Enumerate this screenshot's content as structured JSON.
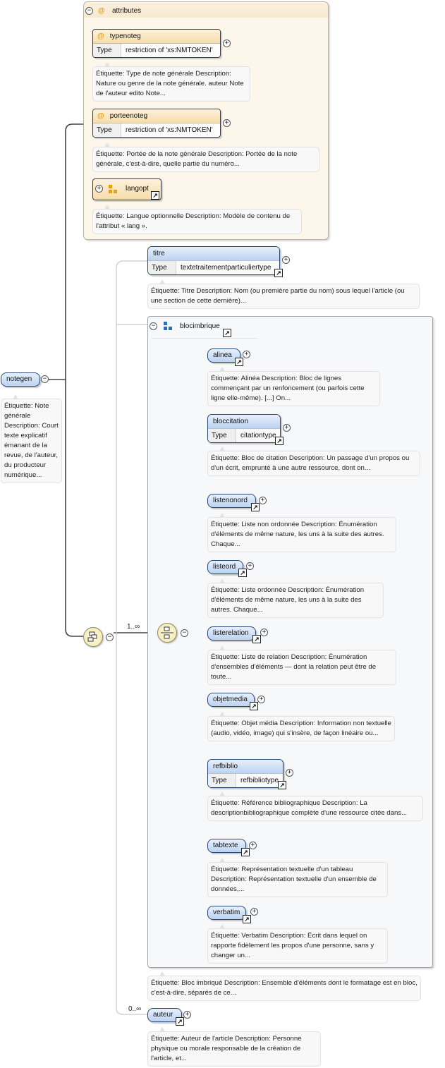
{
  "root": {
    "name": "notegen",
    "annotation": "Étiquette: Note générale Description: Court texte explicatif émanant de la revue, de l'auteur, du producteur numérique..."
  },
  "attributes": {
    "label": "attributes",
    "items": [
      {
        "name": "typenoteg",
        "type_label": "Type",
        "type_value": "restriction of 'xs:NMTOKEN'",
        "annotation": "Étiquette: Type de note générale Description: Nature ou genre de la note générale. auteur Note de l'auteur edito Note..."
      },
      {
        "name": "porteenoteg",
        "type_label": "Type",
        "type_value": "restriction of 'xs:NMTOKEN'",
        "annotation": "Étiquette: Portée de la note générale Description: Portée de la note générale, c'est-à-dire, quelle partie du numéro..."
      },
      {
        "name": "langopt",
        "annotation": "Étiquette: Langue optionnelle Description: Modèle de contenu de l'attribut « lang »."
      }
    ]
  },
  "sequence": {
    "multiplicity": "1..∞"
  },
  "titre": {
    "name": "titre",
    "type_label": "Type",
    "type_value": "textetraitementparticuliertype",
    "annotation": "Étiquette: Titre Description: Nom (ou première partie du nom) sous lequel l'article (ou une section de cette dernière)..."
  },
  "blocimbrique": {
    "name": "blocimbrique",
    "annotation": "Étiquette: Bloc imbriqué Description: Ensemble d'éléments dont le formatage est en bloc, c'est-à-dire, séparés de ce...",
    "children": [
      {
        "name": "alinea",
        "annotation": "Étiquette: Alinéa Description: Bloc de lignes commençant par un renfoncement (ou parfois cette ligne elle-même). [...] On..."
      },
      {
        "name": "bloccitation",
        "type_label": "Type",
        "type_value": "citationtype",
        "annotation": "Étiquette: Bloc de citation Description: Un passage d'un propos ou d'un écrit, emprunté à une autre ressource, dont on..."
      },
      {
        "name": "listenonord",
        "annotation": "Étiquette: Liste non ordonnée Description: Énumération d'éléments de même nature, les uns à la suite des autres. Chaque..."
      },
      {
        "name": "listeord",
        "annotation": "Étiquette: Liste ordonnée Description: Énumération d'éléments de même nature, les uns à la suite des autres. Chaque..."
      },
      {
        "name": "listerelation",
        "annotation": "Étiquette: Liste de relation Description: Énumération d'ensembles d'éléments — dont la relation peut être de toute..."
      },
      {
        "name": "objetmedia",
        "annotation": "Étiquette: Objet média Description: Information non textuelle (audio, vidéo, image) qui s'insère, de façon linéaire ou..."
      },
      {
        "name": "refbiblio",
        "type_label": "Type",
        "type_value": "refbibliotype",
        "annotation": "Étiquette: Référence bibliographique Description: La descriptionbibliographique complète d'une ressource citée dans..."
      },
      {
        "name": "tabtexte",
        "annotation": "Étiquette: Représentation textuelle d'un tableau Description: Représentation textuelle d'un ensemble de données,..."
      },
      {
        "name": "verbatim",
        "annotation": "Étiquette: Verbatim Description: Écrit dans lequel on rapporte fidèlement les propos d'une personne, sans y changer un..."
      }
    ]
  },
  "auteur": {
    "name": "auteur",
    "multiplicity": "0..∞",
    "annotation": "Étiquette: Auteur de l'article Description: Personne physique ou morale responsable de la création de l'article, et..."
  },
  "symbols": {
    "collapse": "−",
    "expand": "+",
    "reference": "↗",
    "attribute_marker": "@"
  },
  "colors": {
    "attr_background": "#fdf6ea",
    "element_fill": "#bcd3f1",
    "element_border": "#29487a",
    "annotation_bg": "#f8f8f8"
  }
}
